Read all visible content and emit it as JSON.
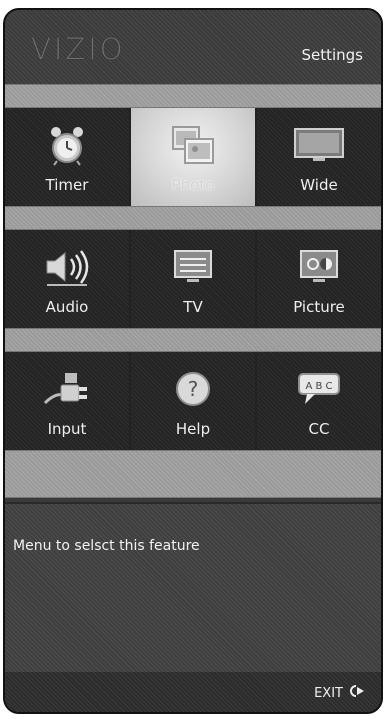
{
  "header": {
    "logo": "VIZIO",
    "title": "Settings"
  },
  "grid": {
    "rows": [
      [
        {
          "label": "Timer",
          "icon": "alarm-clock-icon"
        },
        {
          "label": "Photo",
          "icon": "photo-icon",
          "selected": true
        },
        {
          "label": "Wide",
          "icon": "widescreen-icon"
        }
      ],
      [
        {
          "label": "Audio",
          "icon": "speaker-icon"
        },
        {
          "label": "TV",
          "icon": "tv-icon"
        },
        {
          "label": "Picture",
          "icon": "picture-settings-icon"
        }
      ],
      [
        {
          "label": "Input",
          "icon": "input-plug-icon"
        },
        {
          "label": "Help",
          "icon": "help-icon"
        },
        {
          "label": "CC",
          "icon": "closed-caption-icon"
        }
      ]
    ]
  },
  "description": {
    "text": "Menu to selsct this feature"
  },
  "footer": {
    "exit_label": "EXIT",
    "exit_icon": "exit-arrow-icon"
  },
  "colors": {
    "selected_tile": "#d6d6d6",
    "separator": "#a5a5a5",
    "panel": "#3a3a3a"
  }
}
